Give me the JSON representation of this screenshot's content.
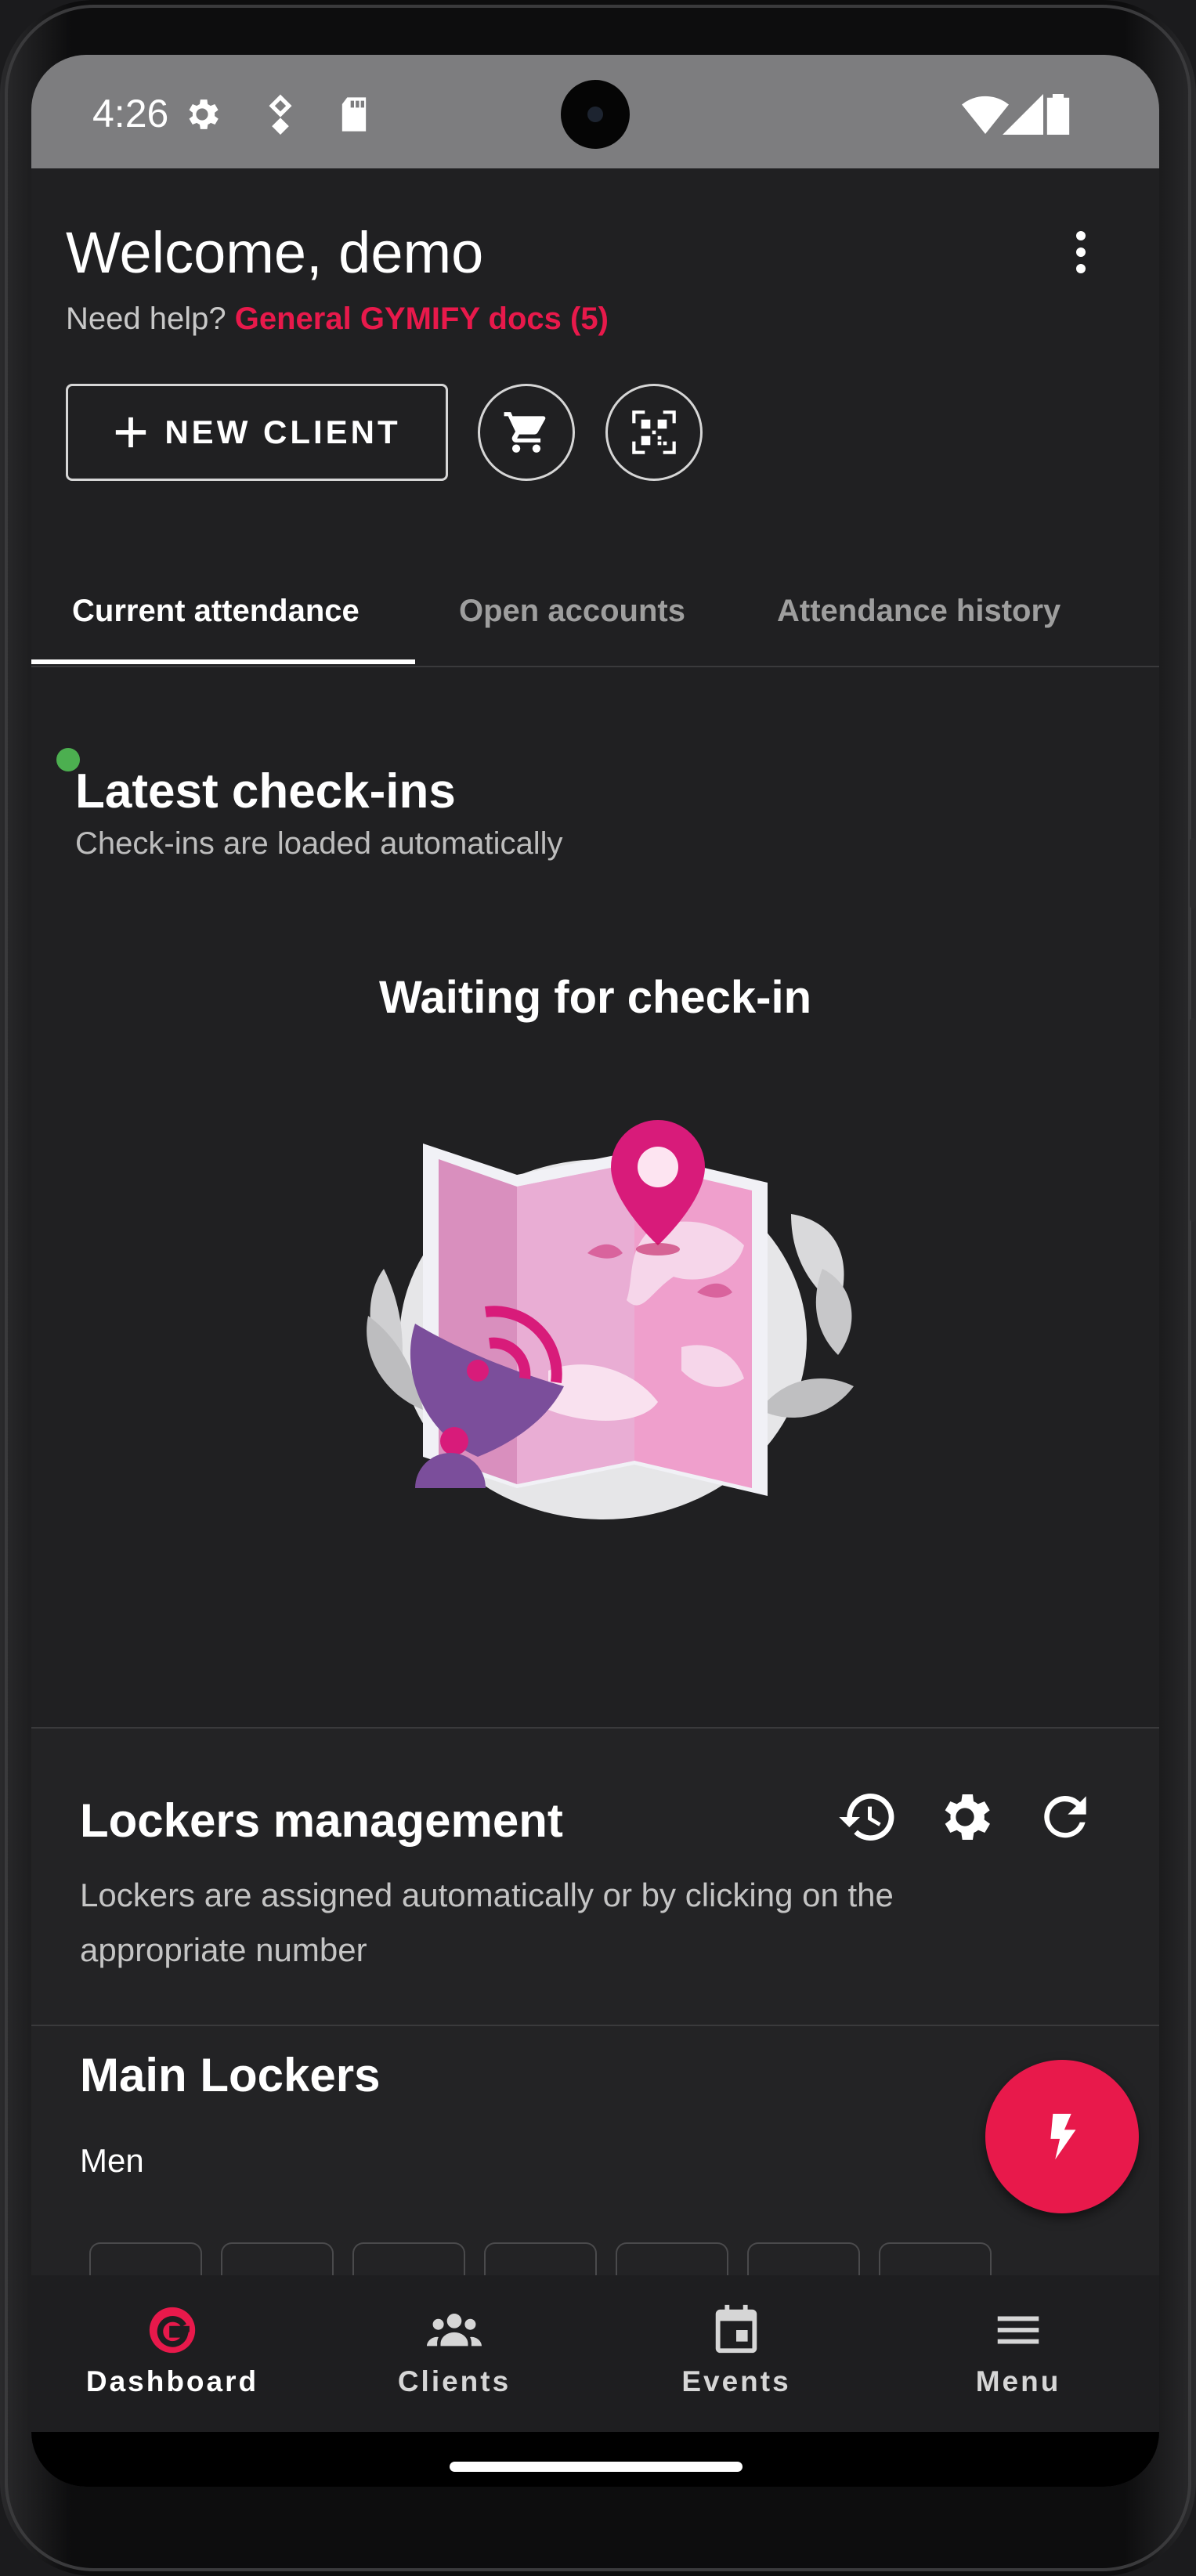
{
  "status_bar": {
    "time": "4:26"
  },
  "header": {
    "welcome": "Welcome, demo",
    "help_prefix": "Need help?",
    "help_link": "General GYMIFY docs (5)"
  },
  "actions": {
    "new_client_label": "NEW CLIENT"
  },
  "tabs": [
    {
      "label": "Current attendance",
      "active": true
    },
    {
      "label": "Open accounts",
      "active": false
    },
    {
      "label": "Attendance history",
      "active": false
    }
  ],
  "checkins": {
    "title": "Latest check-ins",
    "subtitle": "Check-ins are loaded automatically",
    "waiting": "Waiting for check-in"
  },
  "lockers": {
    "title": "Lockers management",
    "description": "Lockers are assigned automatically or by clicking on the appropriate number",
    "group_title": "Main Lockers",
    "section_label": "Men"
  },
  "bottom_nav": [
    {
      "label": "Dashboard",
      "icon": "gymify-logo-icon",
      "active": true
    },
    {
      "label": "Clients",
      "icon": "people-icon",
      "active": false
    },
    {
      "label": "Events",
      "icon": "calendar-icon",
      "active": false
    },
    {
      "label": "Menu",
      "icon": "menu-icon",
      "active": false
    }
  ],
  "colors": {
    "accent": "#e8194b",
    "online": "#4caf50",
    "background": "#202022"
  }
}
